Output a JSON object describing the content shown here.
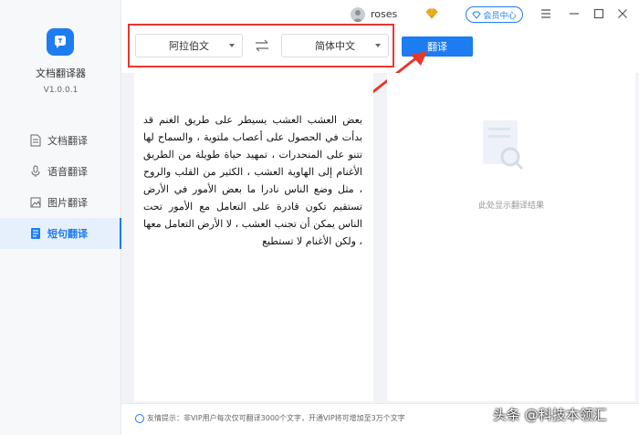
{
  "app": {
    "name": "文档翻译器",
    "version": "V1.0.0.1"
  },
  "sidebar": {
    "items": [
      {
        "label": "文档翻译",
        "icon": "document-icon",
        "active": false
      },
      {
        "label": "语音翻译",
        "icon": "microphone-icon",
        "active": false
      },
      {
        "label": "图片翻译",
        "icon": "image-icon",
        "active": false
      },
      {
        "label": "短句翻译",
        "icon": "short-text-icon",
        "active": true
      }
    ]
  },
  "titlebar": {
    "username": "roses",
    "member_label": "会员中心"
  },
  "toolbar": {
    "source_lang": "阿拉伯文",
    "target_lang": "简体中文",
    "translate_label": "翻译"
  },
  "source": {
    "text": "بعض العشب العشب يسيطر على طريق الغنم قد بدأت في الحصول على أعصاب ملتوية ، والسماح لها تتنو على المنحدرات ، تمهيد حياة طويلة من الطريق الأغنام إلى الهاوية العشب ، الكثير من القلب والروح ، مثل وضع الناس نادرا ما بعض الأمور في الأرض تستقيم تكون قادرة على التعامل مع الأمور تحت الناس يمكن أن تجنب العشب ، لا الأرض التعامل معها ، ولكن الأغنام لا تستطيع"
  },
  "result": {
    "placeholder": "此处显示翻译结果"
  },
  "footer": {
    "tip": "友情提示：非VIP用户每次仅可翻译3000个文字，开通VIP将可增加至3万个文字"
  },
  "watermark": "头条 @科技本领汇",
  "colors": {
    "accent": "#1d7cf2",
    "annotation": "#e8372d"
  }
}
